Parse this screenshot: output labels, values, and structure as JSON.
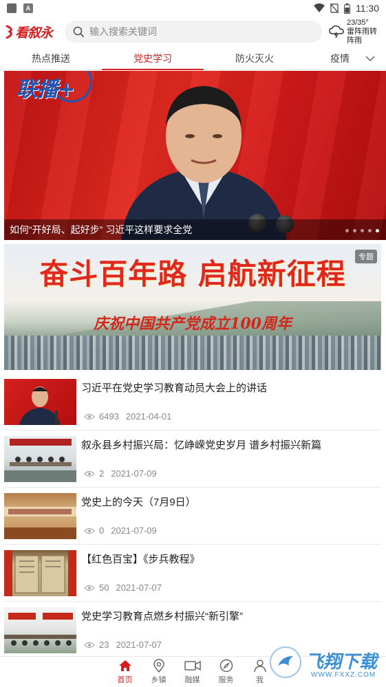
{
  "status_bar": {
    "time": "11:30"
  },
  "header": {
    "logo_text": "看叙永",
    "search_placeholder": "输入搜索关键词",
    "weather": {
      "temp": "23/35°",
      "condition_line1": "雷阵雨转",
      "condition_line2": "阵雨"
    }
  },
  "tabs": [
    {
      "label": "热点推送",
      "active": false
    },
    {
      "label": "党史学习",
      "active": true
    },
    {
      "label": "防火灭火",
      "active": false
    },
    {
      "label": "疫情",
      "active": false
    }
  ],
  "banner": {
    "logo_text": "联播+",
    "caption": "如何“开好局、起好步” 习近平这样要求全党",
    "slide_count": 5,
    "active_slide": 5
  },
  "topic_banner": {
    "title": "奋斗百年路 启航新征程",
    "subtitle": "庆祝中国共产党成立100周年",
    "badge": "专题"
  },
  "news": [
    {
      "title": "习近平在党史学习教育动员大会上的讲话",
      "views": "6493",
      "date": "2021-04-01"
    },
    {
      "title": "叙永县乡村振兴局：忆峥嵘党史岁月 谱乡村振兴新篇",
      "views": "2",
      "date": "2021-07-09"
    },
    {
      "title": "党史上的今天（7月9日）",
      "views": "0",
      "date": "2021-07-09"
    },
    {
      "title": "【红色百宝】《步兵教程》",
      "views": "50",
      "date": "2021-07-07"
    },
    {
      "title": "党史学习教育点燃乡村振兴“新引擎”",
      "views": "23",
      "date": "2021-07-07"
    }
  ],
  "bottom_nav": [
    {
      "label": "首页",
      "icon": "home-icon",
      "active": true
    },
    {
      "label": "乡镇",
      "icon": "location-icon",
      "active": false
    },
    {
      "label": "融媒",
      "icon": "video-icon",
      "active": false
    },
    {
      "label": "服务",
      "icon": "compass-icon",
      "active": false
    },
    {
      "label": "我",
      "icon": "user-icon",
      "active": false
    }
  ],
  "watermark": {
    "text": "飞翔下载",
    "url": "WWW.FXXZ.COM"
  },
  "colors": {
    "accent": "#d71e1e",
    "muted": "#888888"
  }
}
